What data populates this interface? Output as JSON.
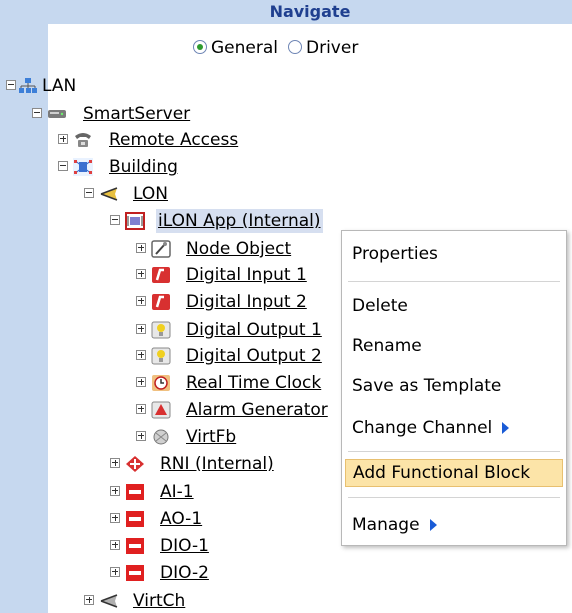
{
  "header": {
    "title": "Navigate"
  },
  "view_mode": {
    "options": [
      {
        "label": "General",
        "selected": true
      },
      {
        "label": "Driver",
        "selected": false
      }
    ]
  },
  "tree": {
    "lan": "LAN",
    "smartserver": "SmartServer",
    "remote_access": "Remote Access",
    "building": "Building",
    "lon": "LON",
    "ilon_app": "iLON App (Internal)",
    "node_object": "Node Object",
    "digital_input_1": "Digital Input 1",
    "digital_input_2": "Digital Input 2",
    "digital_output_1": "Digital Output 1",
    "digital_output_2": "Digital Output 2",
    "real_time_clock": "Real Time Clock",
    "alarm_generator": "Alarm Generator",
    "virtfb": "VirtFb",
    "rni_internal": "RNI (Internal)",
    "ai_1": "AI-1",
    "ao_1": "AO-1",
    "dio_1": "DIO-1",
    "dio_2": "DIO-2",
    "virtch": "VirtCh"
  },
  "context_menu": {
    "properties": "Properties",
    "delete": "Delete",
    "rename": "Rename",
    "save_as_template": "Save as Template",
    "change_channel": "Change Channel",
    "add_functional_block": "Add Functional Block",
    "manage": "Manage"
  },
  "colors": {
    "sidebar": "#c6d8ef",
    "highlight": "#fce4a8",
    "accent": "#1a5bd6"
  }
}
